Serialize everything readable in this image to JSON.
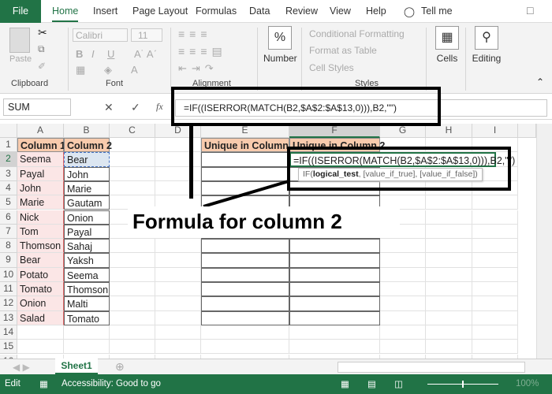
{
  "ribbon_tabs": [
    "File",
    "Home",
    "Insert",
    "Page Layout",
    "Formulas",
    "Data",
    "Review",
    "View",
    "Help",
    "Tell me"
  ],
  "clipboard": {
    "paste": "Paste",
    "label": "Clipboard"
  },
  "font": {
    "name": "Calibri",
    "size": "11",
    "label": "Font"
  },
  "alignment": {
    "label": "Alignment"
  },
  "number": {
    "label": "Number"
  },
  "styles": {
    "conditional": "Conditional Formatting",
    "table": "Format as Table",
    "cell_styles": "Cell Styles",
    "label": "Styles"
  },
  "cells": {
    "label": "Cells"
  },
  "editing": {
    "label": "Editing"
  },
  "formula_bar": {
    "name_box": "SUM",
    "formula": "=IF((ISERROR(MATCH(B2,$A$2:$A$13,0))),B2,\"\")",
    "fx": "fx"
  },
  "columns": [
    "A",
    "B",
    "C",
    "D",
    "E",
    "F",
    "G",
    "H",
    "I"
  ],
  "rows": [
    "1",
    "2",
    "3",
    "4",
    "5",
    "6",
    "7",
    "8",
    "9",
    "10",
    "11",
    "12",
    "13",
    "14",
    "15",
    "16"
  ],
  "column1": {
    "header": "Column 1",
    "values": [
      "Seema",
      "Payal",
      "John",
      "Marie",
      "Nick",
      "Tom",
      "Thomson",
      "Bear",
      "Potato",
      "Tomato",
      "Onion",
      "Salad"
    ]
  },
  "column2": {
    "header": "Column 2",
    "values": [
      "Bear",
      "John",
      "Marie",
      "Gautam",
      "Onion",
      "Payal",
      "Sahaj",
      "Yaksh",
      "Seema",
      "Thomson",
      "Malti",
      "Tomato"
    ]
  },
  "unique1_header": "Unique in Column 1",
  "unique2_header": "Unique in Column 2",
  "cell_edit": "=IF((ISERROR(MATCH(B2,$A$2:$A$13,0))),B2,\"\")",
  "tooltip": {
    "fn": "IF(",
    "bold": "logical_test",
    "rest": ", [value_if_true], [value_if_false])"
  },
  "annotation": "Formula for column 2",
  "sheet_tab": "Sheet1",
  "status": {
    "mode": "Edit",
    "accessibility": "Accessibility: Good to go",
    "zoom": "100%"
  },
  "colors": {
    "excel_green": "#217346",
    "header_fill": "#f8cbad",
    "col_a_fill": "#fbe6e6"
  }
}
